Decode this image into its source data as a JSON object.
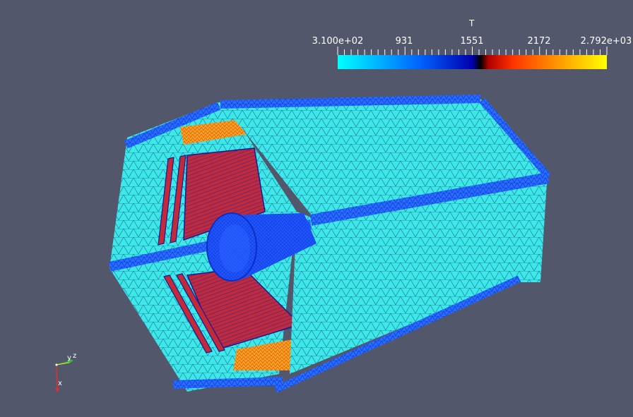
{
  "colorbar": {
    "title": "T",
    "labels": [
      "3.100e+02",
      "931",
      "1551",
      "2172",
      "2.792e+03"
    ],
    "min": 310,
    "max": 2792,
    "colors": [
      "#00ffff",
      "#0066ff",
      "#0000b0",
      "#000000",
      "#b00000",
      "#ff3300",
      "#ff9900",
      "#ffff00"
    ]
  },
  "orientation_axes": {
    "x_label": "x",
    "y_label": "y",
    "z_label": "z",
    "x_color": "#e03030",
    "y_color": "#e8e830",
    "z_color": "#30c030"
  },
  "mesh_colors": {
    "background": "#52576b",
    "outer_shell": "#36f0f0",
    "edge_frame": "#1a5cff",
    "inner_cone": "#1f55ff",
    "hot_plates": "#c0202a",
    "hot_ring": "#ff9a10"
  }
}
